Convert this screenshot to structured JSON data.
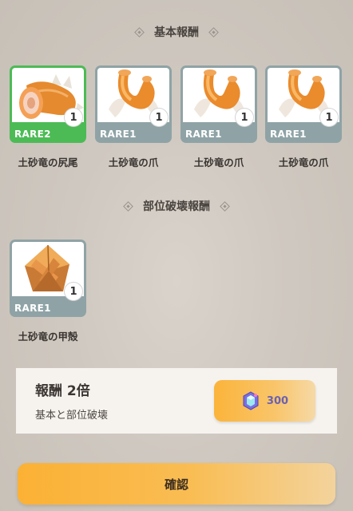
{
  "sections": {
    "basic_title": "基本報酬",
    "part_break_title": "部位破壊報酬"
  },
  "basic_rewards": [
    {
      "rarity": "RARE2",
      "count": "1",
      "name": "土砂竜の尻尾",
      "icon": "tail-icon"
    },
    {
      "rarity": "RARE1",
      "count": "1",
      "name": "土砂竜の爪",
      "icon": "claw-icon"
    },
    {
      "rarity": "RARE1",
      "count": "1",
      "name": "土砂竜の爪",
      "icon": "claw-icon"
    },
    {
      "rarity": "RARE1",
      "count": "1",
      "name": "土砂竜の爪",
      "icon": "claw-icon"
    }
  ],
  "part_break_rewards": [
    {
      "rarity": "RARE1",
      "count": "1",
      "name": "土砂竜の甲殻",
      "icon": "shell-icon"
    }
  ],
  "double_reward": {
    "title": "報酬 2倍",
    "subtitle": "基本と部位破壊",
    "cost": "300",
    "cost_icon": "gem-icon"
  },
  "confirm_label": "確認",
  "colors": {
    "rare1": "#8fa3a6",
    "rare2": "#4cbb55",
    "accent_orange": "#fbb134",
    "gem_text": "#6b61b0"
  }
}
